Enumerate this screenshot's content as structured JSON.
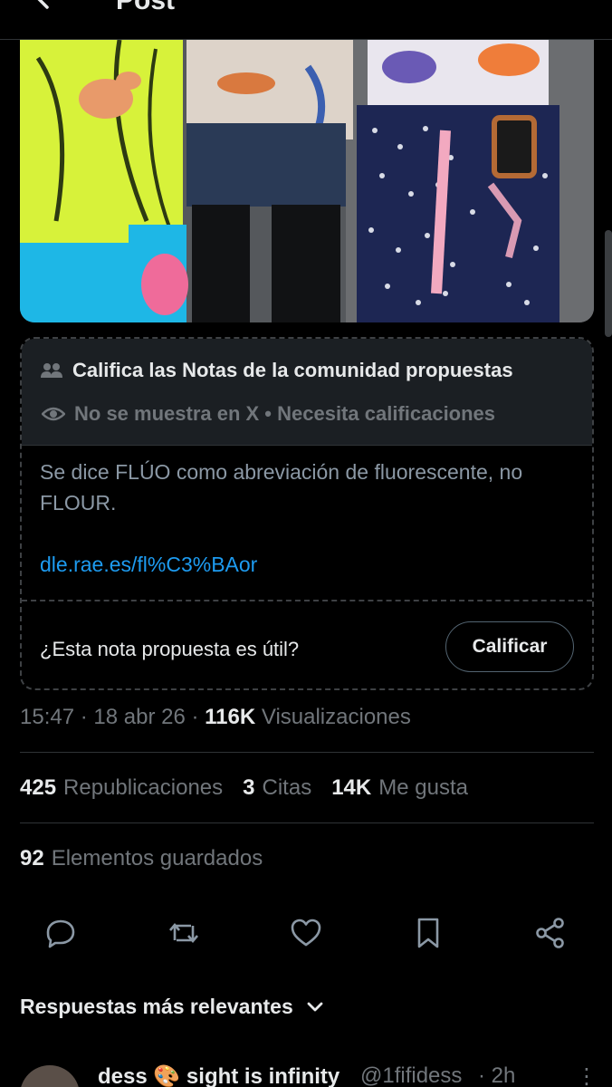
{
  "header": {
    "title": "Post",
    "back_icon": "arrow-left-icon"
  },
  "note": {
    "title": "Califica las Notas de la comunidad propuestas",
    "status": "No se muestra en X • Necesita calificaciones",
    "body": "Se dice FLÚO como abreviación de fluorescente, no FLOUR.",
    "link": "dle.rae.es/fl%C3%BAor",
    "question": "¿Esta nota propuesta es útil?",
    "rate_label": "Calificar",
    "icons": [
      "people-icon",
      "eye-icon"
    ]
  },
  "meta": {
    "time": "15:47",
    "sep1": " · ",
    "date": "18 abr 26",
    "sep2": " · ",
    "views": "116K",
    "views_label": " Visualizaciones"
  },
  "stats": {
    "reposts": "425",
    "reposts_label": "Republicaciones",
    "quotes": "3",
    "quotes_label": "Citas",
    "likes": "14K",
    "likes_label": "Me gusta",
    "saved": "92",
    "saved_label": "Elementos guardados"
  },
  "actions": [
    "reply-icon",
    "repost-icon",
    "like-icon",
    "bookmark-icon",
    "share-icon"
  ],
  "replies": {
    "sort_label": "Respuestas más relevantes"
  },
  "reply": {
    "name": "dess 🎨 sight is infinity",
    "handle": "@1fifidess",
    "time": "· 2h",
    "more": "⋮"
  },
  "colors": {
    "accent": "#1d9bf0",
    "note_header_bg": "#1b1f23",
    "muted": "#71767b",
    "text": "#e7e9ea"
  }
}
